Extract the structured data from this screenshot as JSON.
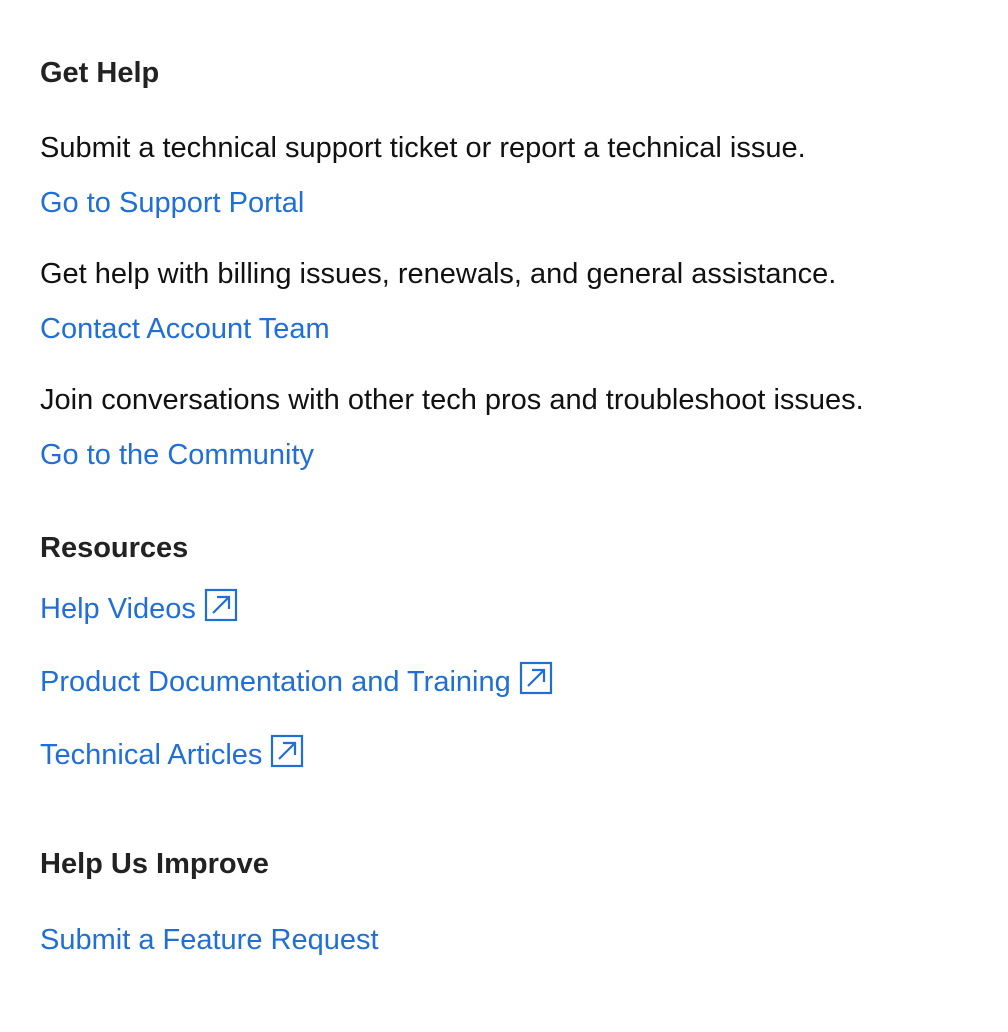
{
  "get_help": {
    "heading": "Get Help",
    "items": [
      {
        "description": "Submit a technical support ticket or report a technical issue.",
        "link_label": "Go to Support Portal"
      },
      {
        "description": "Get help with billing issues, renewals, and general assistance.",
        "link_label": "Contact Account Team"
      },
      {
        "description": "Join conversations with other tech pros and troubleshoot issues.",
        "link_label": "Go to the Community"
      }
    ]
  },
  "resources": {
    "heading": "Resources",
    "links": [
      {
        "label": "Help Videos",
        "icon": "external-link-icon"
      },
      {
        "label": "Product Documentation and Training",
        "icon": "external-link-icon"
      },
      {
        "label": "Technical Articles",
        "icon": "external-link-icon"
      }
    ]
  },
  "help_us_improve": {
    "heading": "Help Us Improve",
    "link_label": "Submit a Feature Request"
  },
  "colors": {
    "link": "#1f6fd6",
    "heading": "#222222",
    "text": "#111111",
    "background": "#ffffff"
  }
}
